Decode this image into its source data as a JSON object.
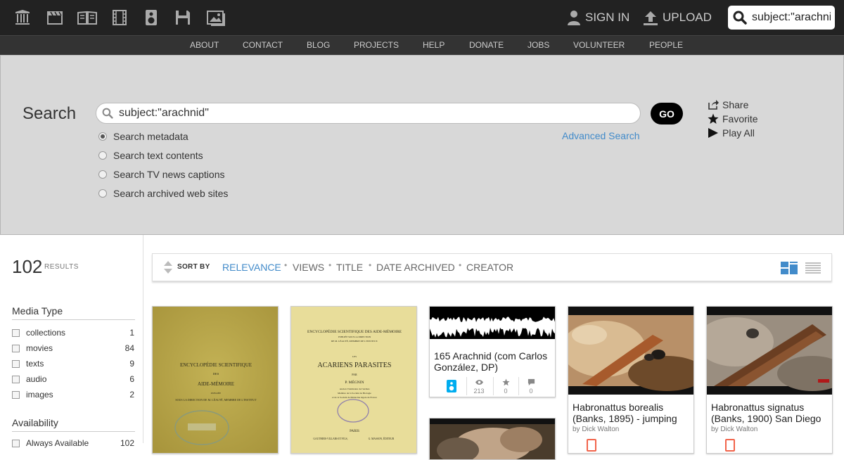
{
  "top_bar": {
    "media_icons": [
      "web-archive-icon",
      "video-reel-icon",
      "book-icon",
      "film-icon",
      "audio-speaker-icon",
      "software-disk-icon",
      "image-gallery-icon"
    ],
    "sign_in": "SIGN IN",
    "upload": "UPLOAD",
    "search_value": "subject:\"arachnid\""
  },
  "nav": {
    "links": [
      "ABOUT",
      "CONTACT",
      "BLOG",
      "PROJECTS",
      "HELP",
      "DONATE",
      "JOBS",
      "VOLUNTEER",
      "PEOPLE"
    ]
  },
  "search_panel": {
    "title": "Search",
    "query": "subject:\"arachnid\"",
    "go": "GO",
    "advanced": "Advanced Search",
    "options": [
      {
        "label": "Search metadata",
        "selected": true
      },
      {
        "label": "Search text contents",
        "selected": false
      },
      {
        "label": "Search TV news captions",
        "selected": false
      },
      {
        "label": "Search archived web sites",
        "selected": false
      }
    ],
    "actions": [
      "Share",
      "Favorite",
      "Play All"
    ]
  },
  "results": {
    "count": "102",
    "label": "RESULTS"
  },
  "facets": {
    "media_type_title": "Media Type",
    "media_types": [
      {
        "label": "collections",
        "count": "1"
      },
      {
        "label": "movies",
        "count": "84"
      },
      {
        "label": "texts",
        "count": "9"
      },
      {
        "label": "audio",
        "count": "6"
      },
      {
        "label": "images",
        "count": "2"
      }
    ],
    "availability_title": "Availability",
    "availability": [
      {
        "label": "Always Available",
        "count": "102"
      }
    ]
  },
  "sort": {
    "label": "SORT BY",
    "options": [
      "RELEVANCE",
      "VIEWS",
      "TITLE",
      "DATE ARCHIVED",
      "CREATOR"
    ],
    "active": "RELEVANCE"
  },
  "items": [
    {
      "title": "165 Arachnid (com Carlos González, DP)",
      "views": "213",
      "favorites": "0",
      "reviews": "0",
      "media_icon": "audio-speaker-icon"
    },
    {
      "title": "Habronattus borealis (Banks, 1895) - jumping",
      "byline": "by Dick Walton",
      "media_icon": "film-icon"
    },
    {
      "title": "Habronattus signatus (Banks, 1900) San Diego",
      "byline": "by Dick Walton",
      "media_icon": "film-icon"
    }
  ],
  "book_covers": [
    {
      "lines": [
        "ENCYCLOPÉDIE SCIENTIFIQUE",
        "DES",
        "AIDE-MÉMOIRE",
        "PUBLIÉE",
        "SOUS LA DIRECTION DE M. LÉAUTÉ, MEMBRE DE L'INSTITUT"
      ]
    },
    {
      "lines": [
        "ENCYCLOPÉDIE SCIENTIFIQUE DES AIDE-MÉMOIRE",
        "PUBLIÉE SOUS LA DIRECTION",
        "DE M. LÉAUTÉ, MEMBRE DE L'INSTITUT.",
        "LES",
        "ACARIENS PARASITES",
        "PAR",
        "P. MÉGNIN",
        "Ancien Vétérinaire de l'Armée",
        "Membre de la Société de Biologie",
        "et de la Société de Médecine légale de France",
        "PARIS",
        "GAUTHIER-VILLARS ET FILS,",
        "G. MASSON, ÉDITEUR"
      ]
    }
  ],
  "colors": {
    "accent": "#428bca",
    "topbar": "#222222",
    "navbar": "#333333",
    "panel": "#d8d8d8",
    "audio_badge": "#00adef",
    "movie_badge": "#f1644b"
  }
}
